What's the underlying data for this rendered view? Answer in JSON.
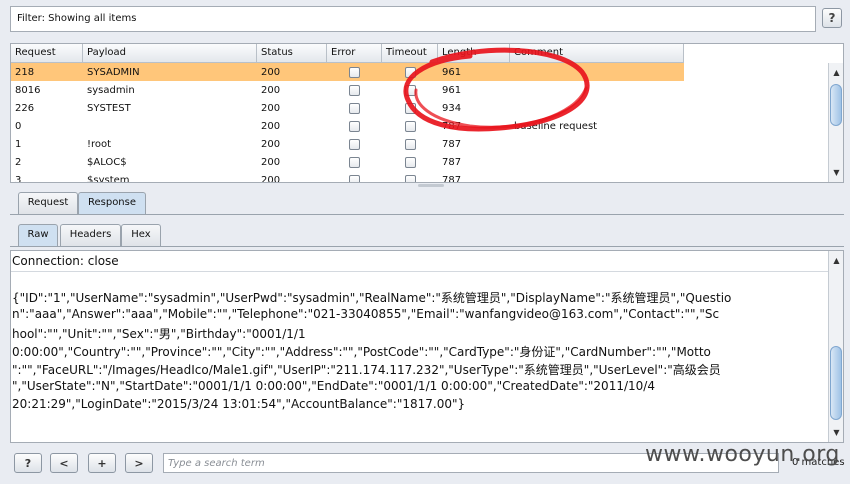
{
  "filter": {
    "text": "Filter: Showing all items"
  },
  "help_label": "?",
  "table": {
    "columns": [
      "Request",
      "Payload",
      "Status",
      "Error",
      "Timeout",
      "Length",
      "Comment"
    ],
    "rows": [
      {
        "request": "218",
        "payload": "SYSADMIN",
        "status": "200",
        "length": "961",
        "comment": "",
        "selected": true
      },
      {
        "request": "8016",
        "payload": "sysadmin",
        "status": "200",
        "length": "961",
        "comment": ""
      },
      {
        "request": "226",
        "payload": "SYSTEST",
        "status": "200",
        "length": "934",
        "comment": ""
      },
      {
        "request": "0",
        "payload": "",
        "status": "200",
        "length": "787",
        "comment": "baseline request"
      },
      {
        "request": "1",
        "payload": "!root",
        "status": "200",
        "length": "787",
        "comment": ""
      },
      {
        "request": "2",
        "payload": "$ALOC$",
        "status": "200",
        "length": "787",
        "comment": ""
      },
      {
        "request": "3",
        "payload": "$system",
        "status": "200",
        "length": "787",
        "comment": ""
      }
    ]
  },
  "tabs_top": {
    "request": "Request",
    "response": "Response"
  },
  "tabs_sub": {
    "raw": "Raw",
    "headers": "Headers",
    "hex": "Hex"
  },
  "response": {
    "connection": "Connection: close",
    "body_lines": [
      "{\"ID\":\"1\",\"UserName\":\"sysadmin\",\"UserPwd\":\"sysadmin\",\"RealName\":\"系统管理员\",\"DisplayName\":\"系统管理员\",\"Questio",
      "n\":\"aaa\",\"Answer\":\"aaa\",\"Mobile\":\"\",\"Telephone\":\"021-33040855\",\"Email\":\"wanfangvideo@163.com\",\"Contact\":\"\",\"Sc",
      "hool\":\"\",\"Unit\":\"\",\"Sex\":\"男\",\"Birthday\":\"0001/1/1",
      "0:00:00\",\"Country\":\"\",\"Province\":\"\",\"City\":\"\",\"Address\":\"\",\"PostCode\":\"\",\"CardType\":\"身份证\",\"CardNumber\":\"\",\"Motto",
      "\":\"\",\"FaceURL\":\"/Images/HeadIco/Male1.gif\",\"UserIP\":\"211.174.117.232\",\"UserType\":\"系统管理员\",\"UserLevel\":\"高级会员",
      "\",\"UserState\":\"N\",\"StartDate\":\"0001/1/1 0:00:00\",\"EndDate\":\"0001/1/1 0:00:00\",\"CreatedDate\":\"2011/10/4",
      "20:21:29\",\"LoginDate\":\"2015/3/24 13:01:54\",\"AccountBalance\":\"1817.00\"}"
    ]
  },
  "search": {
    "help": "?",
    "prev": "<",
    "add": "+",
    "next": ">",
    "placeholder": "Type a search term",
    "matches": "0 matches"
  },
  "watermark": "www.wooyun.org",
  "colors": {
    "selected_row": "#ffc67a",
    "annotation": "#e8141c"
  }
}
